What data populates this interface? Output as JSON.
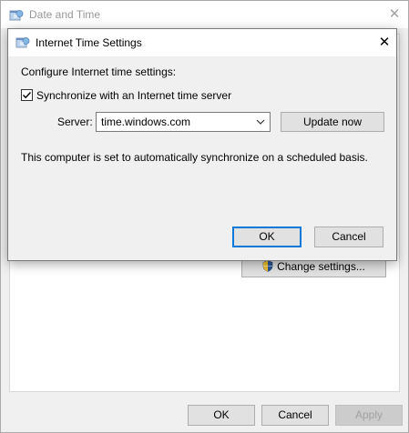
{
  "parent_window": {
    "title": "Date and Time",
    "close_glyph": "✕",
    "change_settings_label": "Change settings...",
    "ok_label": "OK",
    "cancel_label": "Cancel",
    "apply_label": "Apply",
    "apply_enabled": false
  },
  "dialog": {
    "title": "Internet Time Settings",
    "close_glyph": "✕",
    "configure_label": "Configure Internet time settings:",
    "sync_checkbox": {
      "label": "Synchronize with an Internet time server",
      "checked": true
    },
    "server_label": "Server:",
    "server_value": "time.windows.com",
    "update_now_label": "Update now",
    "status_text": "This computer is set to automatically synchronize on a scheduled basis.",
    "ok_label": "OK",
    "cancel_label": "Cancel"
  },
  "colors": {
    "accent": "#0078d7",
    "dialog_bg": "#f0f0f0",
    "button_bg": "#e1e1e1"
  },
  "icons": {
    "window_icon": "date-time-globe-icon",
    "shield": "uac-shield-icon",
    "dropdown": "chevron-down-icon",
    "checkbox_check": "check-icon"
  }
}
